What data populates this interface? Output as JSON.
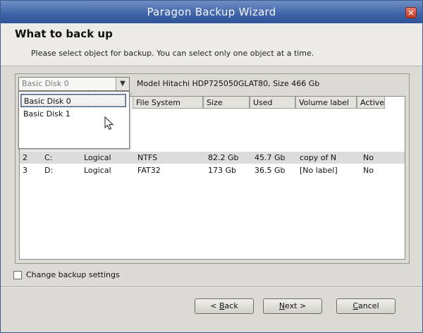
{
  "window": {
    "title": "Paragon Backup Wizard",
    "close_glyph": "✕"
  },
  "header": {
    "title": "What to back up",
    "subtitle": "Please select object for backup. You can select only one object at a time."
  },
  "disk_select": {
    "value": "Basic Disk 0",
    "arrow_glyph": "▼",
    "options": [
      "Basic Disk 0",
      "Basic Disk 1"
    ]
  },
  "model_info": "Model Hitachi HDP725050GLAT80, Size 466 Gb",
  "table": {
    "columns": [
      "File System",
      "Size",
      "Used",
      "Volume label",
      "Active"
    ],
    "rows": [
      {
        "num": "2",
        "drive": "C:",
        "type": "Logical",
        "fs": "NTFS",
        "size": "82.2 Gb",
        "used": "45.7 Gb",
        "label": "copy of N",
        "active": "No"
      },
      {
        "num": "3",
        "drive": "D:",
        "type": "Logical",
        "fs": "FAT32",
        "size": "173 Gb",
        "used": "36.5 Gb",
        "label": "[No label]",
        "active": "No"
      }
    ]
  },
  "options": {
    "change_settings_label": "Change backup settings"
  },
  "buttons": {
    "back": {
      "prefix": "< ",
      "accel": "B",
      "rest": "ack"
    },
    "next": {
      "prefix": "",
      "accel": "N",
      "rest": "ext >"
    },
    "cancel": {
      "prefix": "",
      "accel": "C",
      "rest": "ancel"
    }
  },
  "colors": {
    "titlebar": "#3f63a8",
    "background": "#dcdad5",
    "selection_border": "#4f6ea4"
  }
}
